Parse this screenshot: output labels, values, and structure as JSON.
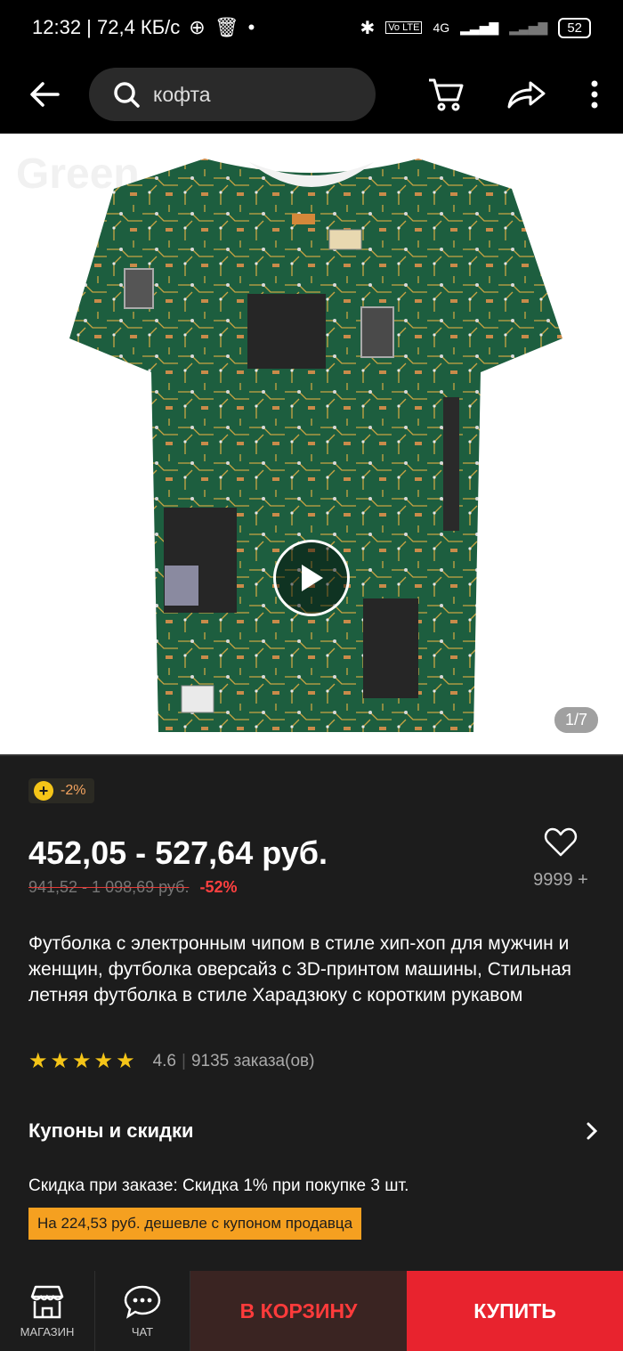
{
  "status_bar": {
    "time_speed": "12:32 | 72,4 КБ/с",
    "network": "4G",
    "battery": "52"
  },
  "search": {
    "query": "кофта"
  },
  "gallery": {
    "ghost_text": "Green",
    "pager": "1/7"
  },
  "product": {
    "coin_discount": "-2%",
    "price": "452,05 - 527,64 руб.",
    "old_price": "941,52 - 1 098,69 руб.",
    "discount": "-52%",
    "wishlist_count": "9999 +",
    "title": "Футболка с электронным чипом в стиле хип-хоп для мужчин и женщин, футболка оверсайз с 3D-принтом машины, Стильная летняя футболка в стиле Харадзюку с коротким рукавом",
    "rating": "4.6",
    "orders": "9135 заказа(ов)",
    "stars": 5
  },
  "coupons": {
    "heading": "Купоны и скидки",
    "order_discount": "Скидка при заказе: Скидка 1% при покупке 3 шт.",
    "promo": "На 224,53 руб. дешевле с купоном продавца"
  },
  "bottom_bar": {
    "store_label": "МАГАЗИН",
    "chat_label": "ЧАТ",
    "cart_label": "В КОРЗИНУ",
    "buy_label": "КУПИТЬ"
  },
  "colors": {
    "accent_red": "#e8232e",
    "promo_orange": "#f5a020",
    "star_yellow": "#f5c518",
    "pcb_green": "#1d5e3f"
  }
}
